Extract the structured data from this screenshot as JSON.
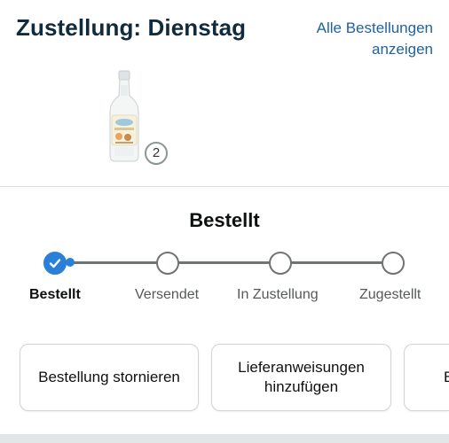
{
  "header": {
    "title": "Zustellung: Dienstag",
    "view_all_line1": "Alle Bestellungen",
    "view_all_line2": "anzeigen"
  },
  "item": {
    "image": "white-rum-bottle",
    "quantity": "2"
  },
  "status": {
    "heading": "Bestellt",
    "steps": [
      {
        "label": "Bestellt",
        "state": "done"
      },
      {
        "label": "Versendet",
        "state": "pending"
      },
      {
        "label": "In Zustellung",
        "state": "pending"
      },
      {
        "label": "Zugestellt",
        "state": "pending"
      }
    ]
  },
  "actions": [
    {
      "line1": "Bestellung stornieren",
      "line2": ""
    },
    {
      "line1": "Lieferanweisungen",
      "line2": "hinzufügen"
    },
    {
      "line1": "B",
      "line2": ""
    }
  ],
  "colors": {
    "title": "#0f2b3d",
    "link": "#2162a1",
    "progress_active": "#2a7fd6",
    "progress_inactive": "#6f7373"
  }
}
